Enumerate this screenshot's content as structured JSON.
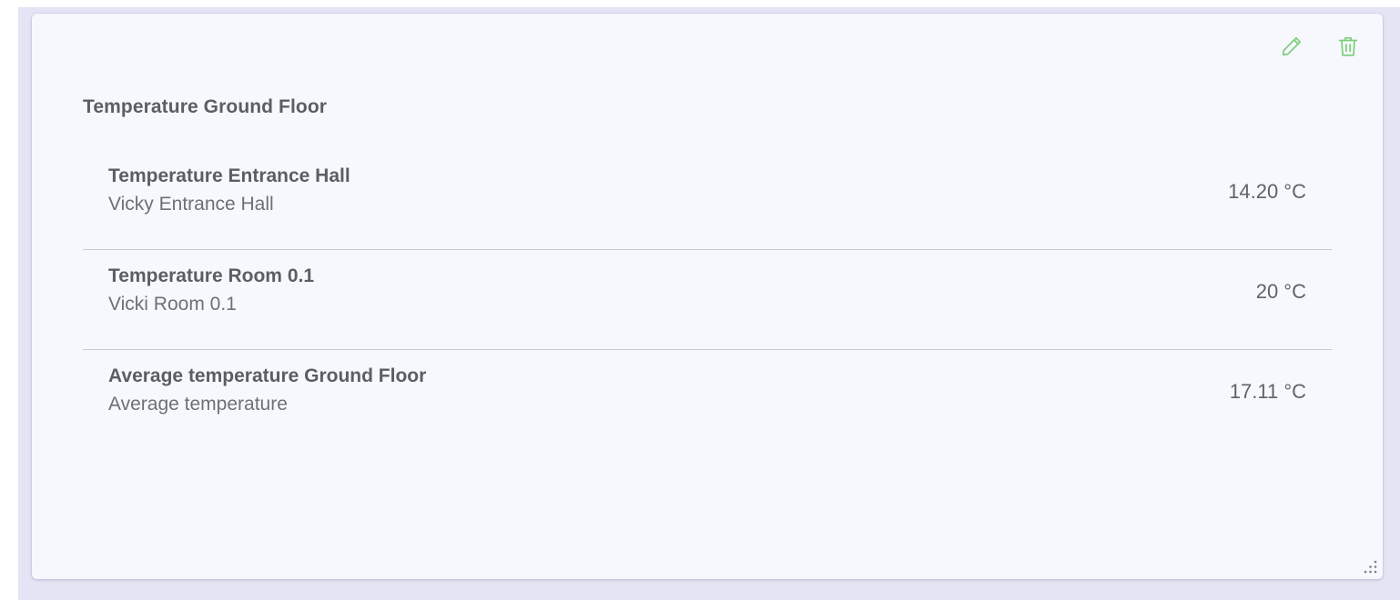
{
  "widget": {
    "title": "Temperature Ground Floor",
    "actions": {
      "edit_icon": "pencil-icon",
      "delete_icon": "trash-icon",
      "icon_color": "#7ccf7c"
    },
    "rows": [
      {
        "name": "Temperature Entrance Hall",
        "device": "Vicky Entrance Hall",
        "value": "14.20 °C"
      },
      {
        "name": "Temperature Room 0.1",
        "device": "Vicki Room 0.1",
        "value": "20 °C"
      },
      {
        "name": "Average temperature Ground Floor",
        "device": "Average temperature",
        "value": "17.11 °C"
      }
    ]
  }
}
